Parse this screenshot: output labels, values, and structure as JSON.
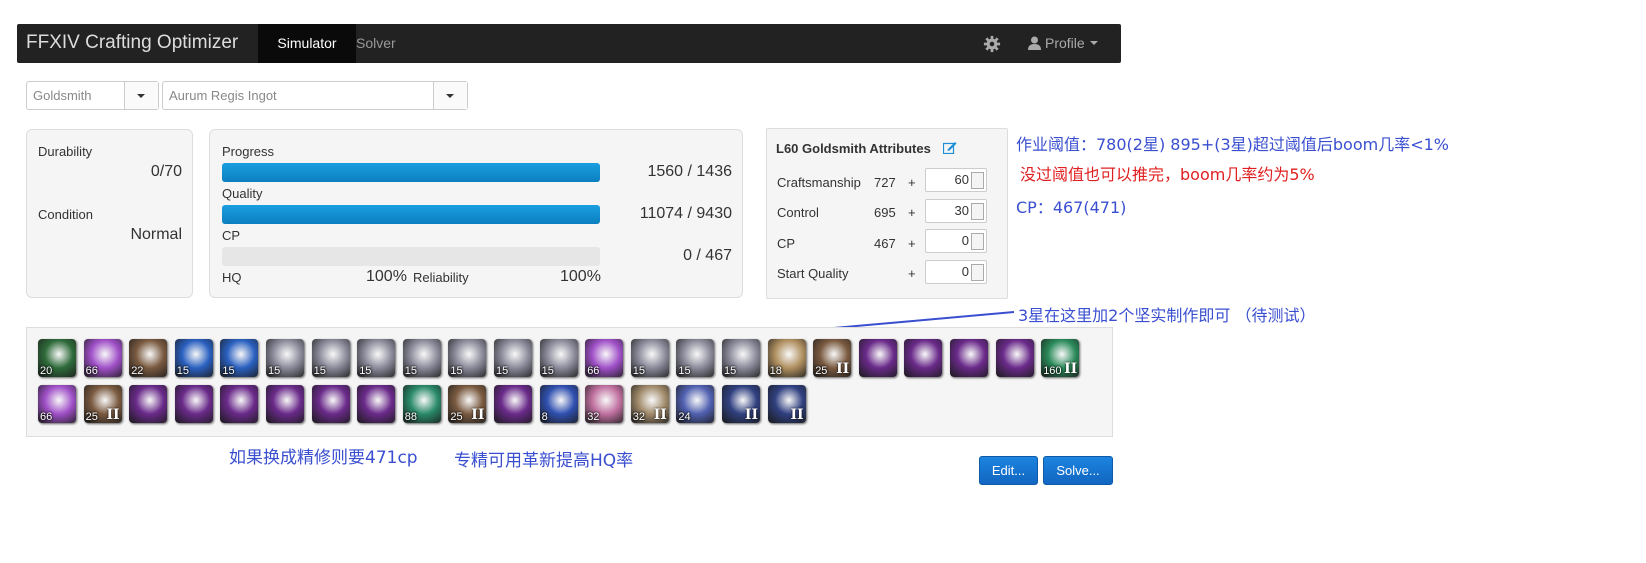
{
  "navbar": {
    "brand": "FFXIV Crafting Optimizer",
    "tabs": [
      "Simulator",
      "Solver"
    ],
    "profile_label": "Profile"
  },
  "selects": {
    "class": "Goldsmith",
    "recipe": "Aurum Regis Ingot"
  },
  "status": {
    "durability_label": "Durability",
    "durability_value": "0/70",
    "condition_label": "Condition",
    "condition_value": "Normal"
  },
  "progress": {
    "progress_label": "Progress",
    "progress_value": "1560 / 1436",
    "progress_fill": 1.0,
    "quality_label": "Quality",
    "quality_value": "11074 / 9430",
    "quality_fill": 1.0,
    "cp_label": "CP",
    "cp_value": "0 / 467",
    "cp_fill": 0.0,
    "hq_label": "HQ",
    "hq_value": "100%",
    "reliability_label": "Reliability",
    "reliability_value": "100%"
  },
  "attributes": {
    "title": "L60 Goldsmith Attributes",
    "rows": [
      {
        "label": "Craftsmanship",
        "base": "727",
        "plus": "+",
        "input": "60"
      },
      {
        "label": "Control",
        "base": "695",
        "plus": "+",
        "input": "30"
      },
      {
        "label": "CP",
        "base": "467",
        "plus": "+",
        "input": "0"
      },
      {
        "label": "Start Quality",
        "base": "",
        "plus": "+",
        "input": "0"
      }
    ]
  },
  "notes": {
    "line1": "作业阈值：780(2星) 895+(3星)超过阈值后boom几率<1%",
    "line2": "没过阈值也可以推完，boom几率约为5%",
    "line3": "CP：467(471)",
    "line4": "3星在这里加2个坚实制作即可 （待测试）",
    "line5": "如果换成精修则要471cp",
    "line6": "专精可用革新提高HQ率"
  },
  "actions": {
    "row1": [
      {
        "name": "comfort-zone",
        "num": "20",
        "ii": "",
        "color": "#2f6b3a"
      },
      {
        "name": "inner-quiet",
        "num": "66",
        "ii": "",
        "color": "#a050c8"
      },
      {
        "name": "hand-touch",
        "num": "22",
        "ii": "",
        "color": "#7a5a40"
      },
      {
        "name": "great-strides",
        "num": "15",
        "ii": "",
        "color": "#2a60c0"
      },
      {
        "name": "great-strides",
        "num": "15",
        "ii": "",
        "color": "#2a60c0"
      },
      {
        "name": "steady-hand",
        "num": "15",
        "ii": "",
        "color": "#8a8a9a"
      },
      {
        "name": "steady-hand",
        "num": "15",
        "ii": "",
        "color": "#8a8a9a"
      },
      {
        "name": "steady-hand",
        "num": "15",
        "ii": "",
        "color": "#8a8a9a"
      },
      {
        "name": "steady-hand",
        "num": "15",
        "ii": "",
        "color": "#8a8a9a"
      },
      {
        "name": "steady-hand",
        "num": "15",
        "ii": "",
        "color": "#8a8a9a"
      },
      {
        "name": "steady-hand",
        "num": "15",
        "ii": "",
        "color": "#8a8a9a"
      },
      {
        "name": "steady-hand",
        "num": "15",
        "ii": "",
        "color": "#8a8a9a"
      },
      {
        "name": "inner-quiet",
        "num": "66",
        "ii": "",
        "color": "#a050c8"
      },
      {
        "name": "steady-hand",
        "num": "15",
        "ii": "",
        "color": "#8a8a9a"
      },
      {
        "name": "steady-hand",
        "num": "15",
        "ii": "",
        "color": "#8a8a9a"
      },
      {
        "name": "steady-hand",
        "num": "15",
        "ii": "",
        "color": "#8a8a9a"
      },
      {
        "name": "innovation",
        "num": "18",
        "ii": "",
        "color": "#b09060"
      },
      {
        "name": "basic-touch-ii",
        "num": "25",
        "ii": "II",
        "color": "#7a5a40"
      },
      {
        "name": "byregot-touch",
        "num": "",
        "ii": "",
        "color": "#6a2a8a"
      },
      {
        "name": "byregot-touch",
        "num": "",
        "ii": "",
        "color": "#6a2a8a"
      },
      {
        "name": "byregot-touch",
        "num": "",
        "ii": "",
        "color": "#6a2a8a"
      },
      {
        "name": "byregot-touch",
        "num": "",
        "ii": "",
        "color": "#6a2a8a"
      },
      {
        "name": "manipulation-ii",
        "num": "160",
        "ii": "II",
        "color": "#2a8a5a"
      }
    ],
    "row2": [
      {
        "name": "inner-quiet",
        "num": "66",
        "ii": "",
        "color": "#a050c8"
      },
      {
        "name": "basic-touch-ii",
        "num": "25",
        "ii": "II",
        "color": "#7a5a40"
      },
      {
        "name": "byregot-touch",
        "num": "",
        "ii": "",
        "color": "#6a2a8a"
      },
      {
        "name": "byregot-touch",
        "num": "",
        "ii": "",
        "color": "#6a2a8a"
      },
      {
        "name": "byregot-touch",
        "num": "",
        "ii": "",
        "color": "#6a2a8a"
      },
      {
        "name": "byregot-touch",
        "num": "",
        "ii": "",
        "color": "#6a2a8a"
      },
      {
        "name": "byregot-touch",
        "num": "",
        "ii": "",
        "color": "#6a2a8a"
      },
      {
        "name": "byregot-touch",
        "num": "",
        "ii": "",
        "color": "#6a2a8a"
      },
      {
        "name": "manipulation",
        "num": "88",
        "ii": "",
        "color": "#2a8a6a"
      },
      {
        "name": "basic-touch-ii",
        "num": "25",
        "ii": "II",
        "color": "#7a5a40"
      },
      {
        "name": "byregot-touch",
        "num": "",
        "ii": "",
        "color": "#6a2a8a"
      },
      {
        "name": "precise-touch",
        "num": "8",
        "ii": "",
        "color": "#3050b0"
      },
      {
        "name": "reflect",
        "num": "32",
        "ii": "",
        "color": "#c070a0"
      },
      {
        "name": "careful-synthesis-ii",
        "num": "32",
        "ii": "II",
        "color": "#a08a6a"
      },
      {
        "name": "byregots-blessing",
        "num": "24",
        "ii": "",
        "color": "#5060b0"
      },
      {
        "name": "flawless-synthesis-ii",
        "num": "",
        "ii": "II",
        "color": "#304080"
      },
      {
        "name": "flawless-synthesis-ii",
        "num": "",
        "ii": "II",
        "color": "#304080"
      }
    ]
  },
  "buttons": {
    "edit": "Edit...",
    "solve": "Solve..."
  }
}
